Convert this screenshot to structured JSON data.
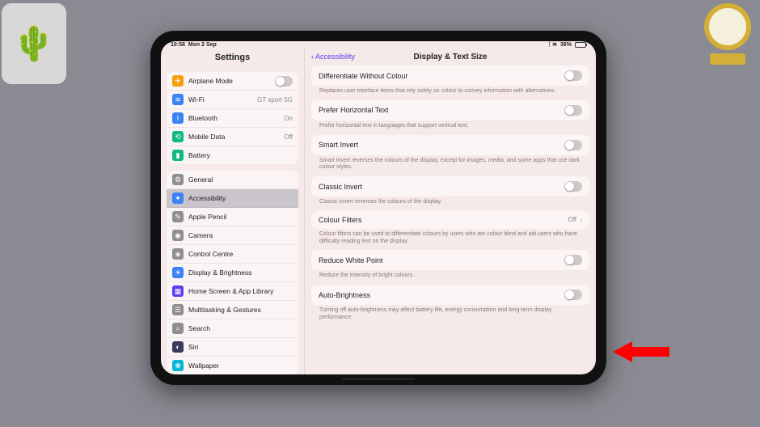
{
  "status": {
    "time": "10:58",
    "date": "Mon 2 Sep",
    "battery_percent": "36%"
  },
  "sidebar": {
    "title": "Settings",
    "group1": [
      {
        "icon": "✈",
        "color": "#f59e0b",
        "label": "Airplane Mode",
        "type": "toggle"
      },
      {
        "icon": "≋",
        "color": "#3b82f6",
        "label": "Wi-Fi",
        "value": "GT sport 5G"
      },
      {
        "icon": "ᚼ",
        "color": "#3b82f6",
        "label": "Bluetooth",
        "value": "On"
      },
      {
        "icon": "⟲",
        "color": "#10b981",
        "label": "Mobile Data",
        "value": "Off"
      },
      {
        "icon": "▮",
        "color": "#10b981",
        "label": "Battery"
      }
    ],
    "group2": [
      {
        "icon": "⚙",
        "color": "#8e8e93",
        "label": "General"
      },
      {
        "icon": "✦",
        "color": "#3b82f6",
        "label": "Accessibility",
        "selected": true
      },
      {
        "icon": "✎",
        "color": "#8e8e93",
        "label": "Apple Pencil"
      },
      {
        "icon": "◉",
        "color": "#8e8e93",
        "label": "Camera"
      },
      {
        "icon": "◈",
        "color": "#8e8e93",
        "label": "Control Centre"
      },
      {
        "icon": "☀",
        "color": "#3b82f6",
        "label": "Display & Brightness"
      },
      {
        "icon": "▦",
        "color": "#5b3df0",
        "label": "Home Screen & App Library"
      },
      {
        "icon": "☰",
        "color": "#8e8e93",
        "label": "Multitasking & Gestures"
      },
      {
        "icon": "⌕",
        "color": "#8e8e93",
        "label": "Search"
      },
      {
        "icon": "◐",
        "color": "#3b3b5b",
        "label": "Siri"
      },
      {
        "icon": "❀",
        "color": "#06b6d4",
        "label": "Wallpaper"
      }
    ]
  },
  "main": {
    "back_label": "Accessibility",
    "title": "Display & Text Size",
    "items": [
      {
        "label": "Differentiate Without Colour",
        "type": "toggle",
        "desc": "Replaces user interface items that rely solely on colour to convey information with alternatives."
      },
      {
        "label": "Prefer Horizontal Text",
        "type": "toggle",
        "desc": "Prefer horizontal text in languages that support vertical text."
      },
      {
        "label": "Smart Invert",
        "type": "toggle",
        "desc": "Smart Invert reverses the colours of the display, except for images, media, and some apps that use dark colour styles."
      },
      {
        "label": "Classic Invert",
        "type": "toggle",
        "desc": "Classic Invert reverses the colours of the display."
      },
      {
        "label": "Colour Filters",
        "type": "link",
        "value": "Off",
        "desc": "Colour filters can be used to differentiate colours by users who are colour blind and aid users who have difficulty reading text on the display."
      },
      {
        "label": "Reduce White Point",
        "type": "toggle",
        "desc": "Reduce the intensity of bright colours."
      },
      {
        "label": "Auto-Brightness",
        "type": "toggle",
        "desc": "Turning off auto-brightness may affect battery life, energy consumption and long-term display performance."
      }
    ]
  }
}
